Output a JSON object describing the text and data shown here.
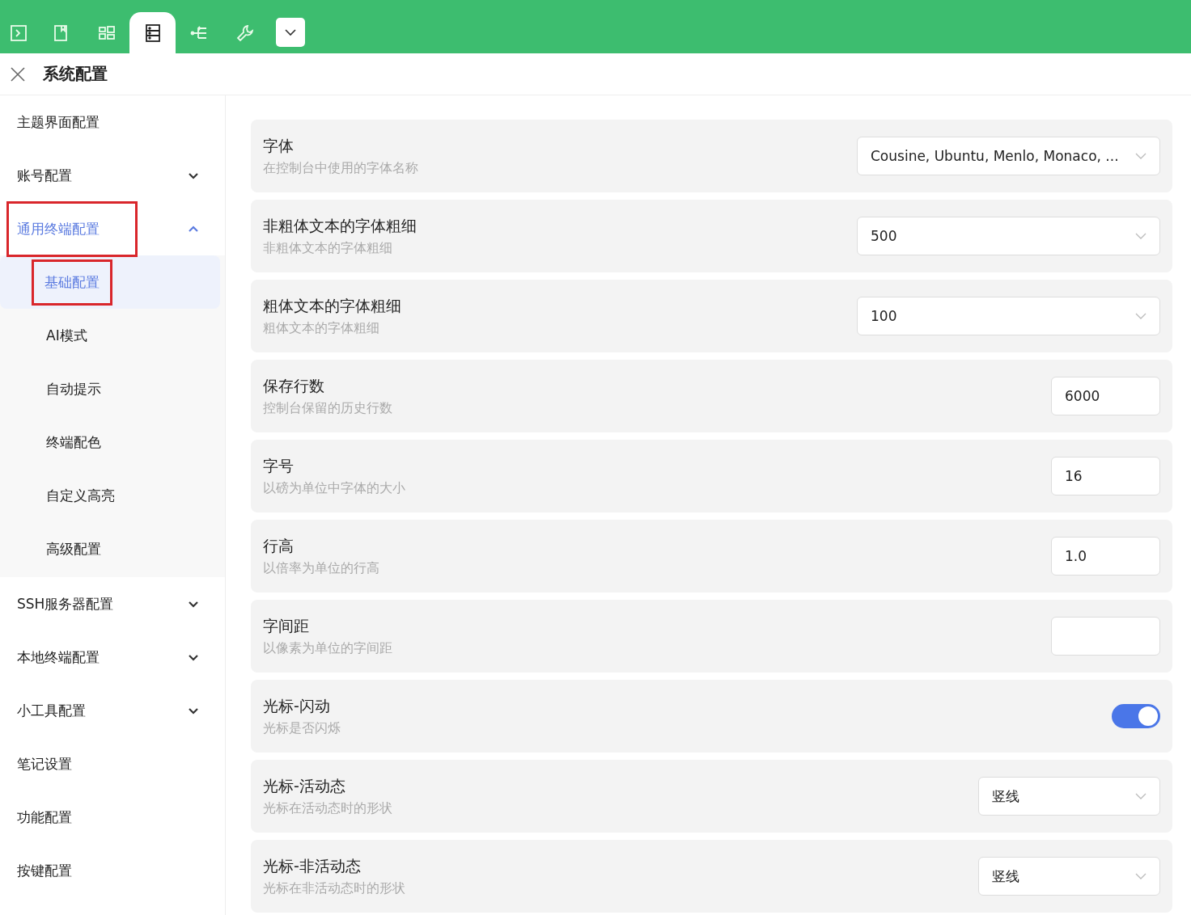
{
  "toolbar": {
    "tabs": [
      {
        "selected": false
      },
      {
        "selected": false
      },
      {
        "selected": false
      },
      {
        "selected": true
      },
      {
        "selected": false
      },
      {
        "selected": false
      }
    ]
  },
  "header": {
    "title": "系统配置"
  },
  "sidebar": {
    "items": [
      {
        "kind": "link",
        "label": "主题界面配置",
        "selected": false,
        "highlighted": false
      },
      {
        "kind": "group",
        "label": "账号配置",
        "expanded": false,
        "selected": false,
        "highlighted": false
      },
      {
        "kind": "group",
        "label": "通用终端配置",
        "expanded": true,
        "selected": true,
        "highlighted": true,
        "children": [
          {
            "label": "基础配置",
            "selected": true,
            "highlighted": true
          },
          {
            "label": "AI模式",
            "selected": false,
            "highlighted": false
          },
          {
            "label": "自动提示",
            "selected": false,
            "highlighted": false
          },
          {
            "label": "终端配色",
            "selected": false,
            "highlighted": false
          },
          {
            "label": "自定义高亮",
            "selected": false,
            "highlighted": false
          },
          {
            "label": "高级配置",
            "selected": false,
            "highlighted": false
          }
        ]
      },
      {
        "kind": "group",
        "label": "SSH服务器配置",
        "expanded": false,
        "selected": false,
        "highlighted": false
      },
      {
        "kind": "group",
        "label": "本地终端配置",
        "expanded": false,
        "selected": false,
        "highlighted": false
      },
      {
        "kind": "group",
        "label": "小工具配置",
        "expanded": false,
        "selected": false,
        "highlighted": false
      },
      {
        "kind": "link",
        "label": "笔记设置",
        "selected": false,
        "highlighted": false
      },
      {
        "kind": "link",
        "label": "功能配置",
        "selected": false,
        "highlighted": false
      },
      {
        "kind": "link",
        "label": "按键配置",
        "selected": false,
        "highlighted": false
      }
    ]
  },
  "settings": [
    {
      "kind": "select",
      "title": "字体",
      "description": "在控制台中使用的字体名称",
      "value": "Cousine, Ubuntu, Menlo, Monaco, ..."
    },
    {
      "kind": "select",
      "title": "非粗体文本的字体粗细",
      "description": "非粗体文本的字体粗细",
      "value": "500"
    },
    {
      "kind": "select",
      "title": "粗体文本的字体粗细",
      "description": "粗体文本的字体粗细",
      "value": "100"
    },
    {
      "kind": "input",
      "title": "保存行数",
      "description": "控制台保留的历史行数",
      "value": "6000"
    },
    {
      "kind": "input",
      "title": "字号",
      "description": "以磅为单位中字体的大小",
      "value": "16"
    },
    {
      "kind": "input",
      "title": "行高",
      "description": "以倍率为单位的行高",
      "value": "1.0"
    },
    {
      "kind": "input",
      "title": "字间距",
      "description": "以像素为单位的字间距"
    },
    {
      "kind": "toggle",
      "title": "光标-闪动",
      "description": "光标是否闪烁",
      "on": true
    },
    {
      "kind": "short-select",
      "title": "光标-活动态",
      "description": "光标在活动态时的形状",
      "value": "竖线"
    },
    {
      "kind": "short-select",
      "title": "光标-非活动态",
      "description": "光标在非活动态时的形状",
      "value": "竖线"
    }
  ]
}
